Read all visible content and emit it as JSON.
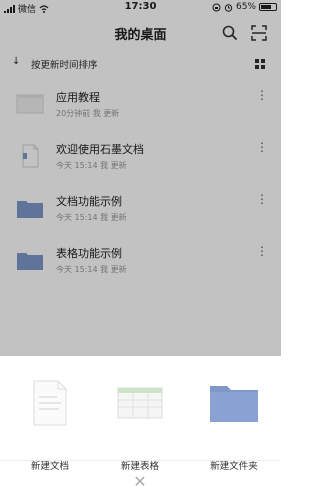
{
  "status_bar": {
    "carrier": "微信",
    "time": "17:30",
    "battery": "65%"
  },
  "navbar": {
    "title": "我的桌面",
    "search_icon": "search-icon",
    "scan_icon": "scan-icon"
  },
  "sort": {
    "label": "按更新时间排序",
    "arrow_icon": "arrow-down-icon",
    "view_icon": "grid-view-icon"
  },
  "items": [
    {
      "name": "应用教程",
      "meta": "20分钟前 我 更新",
      "type": "doc-gray"
    },
    {
      "name": "欢迎使用石墨文档",
      "meta": "今天 15:14 我 更新",
      "type": "doc"
    },
    {
      "name": "文档功能示例",
      "meta": "今天 15:14 我 更新",
      "type": "folder"
    },
    {
      "name": "表格功能示例",
      "meta": "今天 15:14 我 更新",
      "type": "folder"
    }
  ],
  "sheet": {
    "actions": [
      {
        "label": "新建文档",
        "icon": "new-document-icon"
      },
      {
        "label": "新建表格",
        "icon": "new-spreadsheet-icon"
      },
      {
        "label": "新建文件夹",
        "icon": "new-folder-icon"
      }
    ],
    "close_icon": "close-icon"
  },
  "colors": {
    "folder": "#7f97c9",
    "overlay": "rgba(0,0,0,0.24)",
    "sheet_bg": "#ffffff"
  }
}
